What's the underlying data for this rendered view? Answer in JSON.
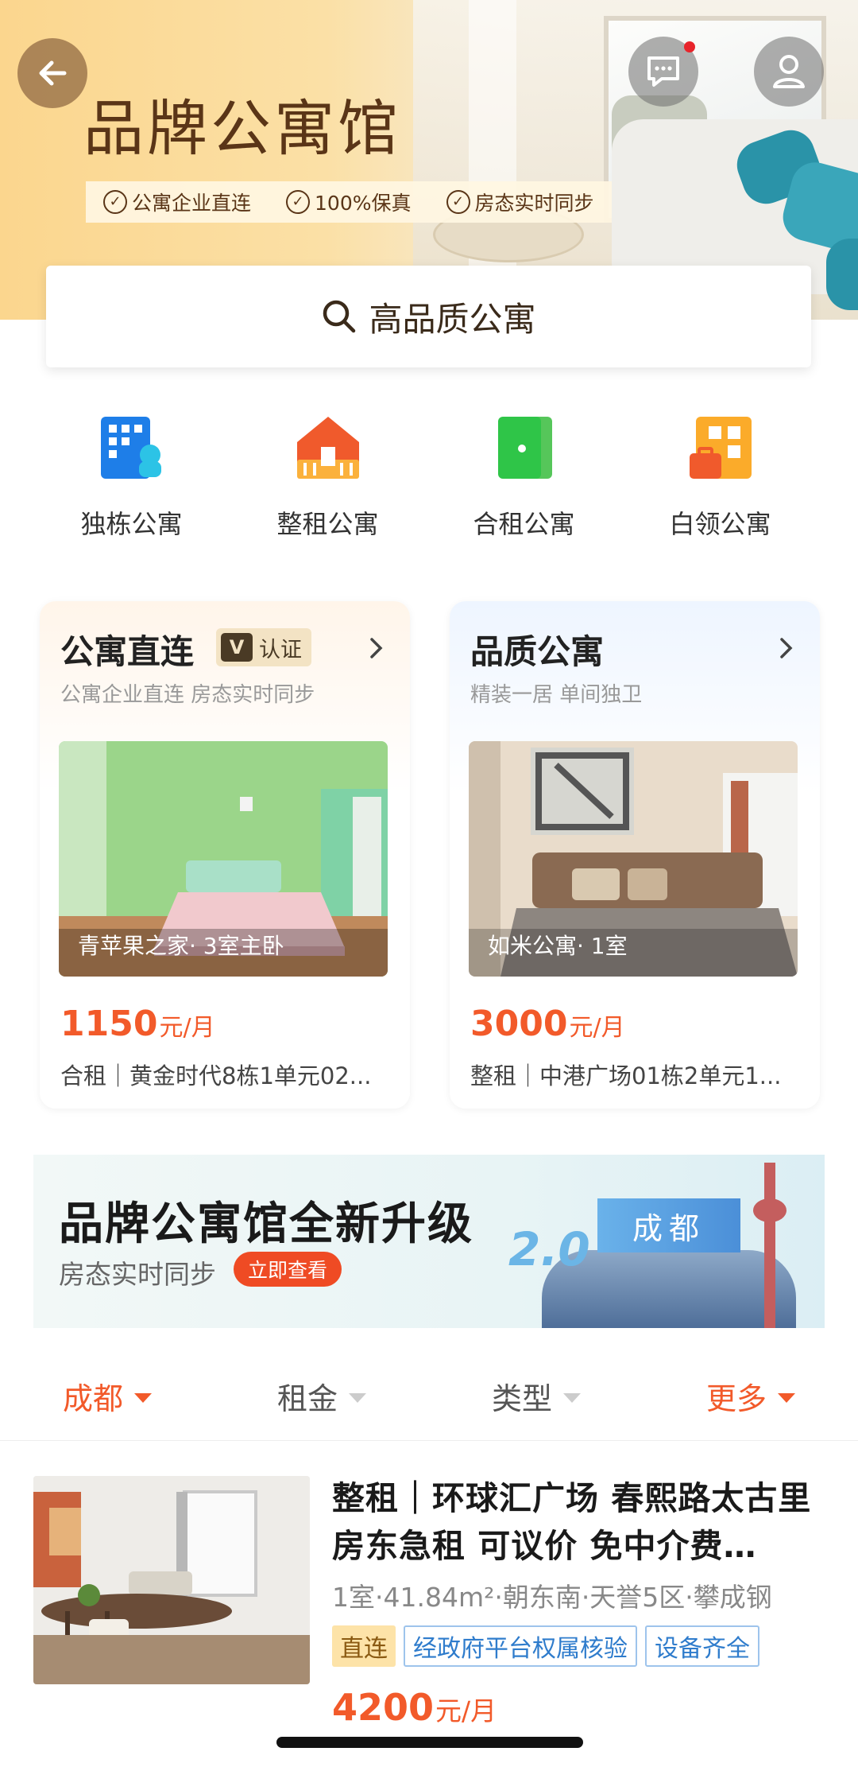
{
  "header": {
    "title": "品牌公寓馆",
    "tags": [
      "公寓企业直连",
      "100%保真",
      "房态实时同步"
    ]
  },
  "search": {
    "placeholder": "高品质公寓"
  },
  "categories": [
    {
      "label": "独栋公寓",
      "icon": "building-icon"
    },
    {
      "label": "整租公寓",
      "icon": "house-icon"
    },
    {
      "label": "合租公寓",
      "icon": "door-icon"
    },
    {
      "label": "白领公寓",
      "icon": "office-icon"
    }
  ],
  "feature_cards": [
    {
      "title": "公寓直连",
      "badge_v": "V",
      "badge": "认证",
      "subtitle": "公寓企业直连 房态实时同步",
      "image_label": "青苹果之家· 3室主卧",
      "price": "1150",
      "unit": "元/月",
      "address": "合租｜黄金时代8栋1单元02..."
    },
    {
      "title": "品质公寓",
      "subtitle": "精装一居 单间独卫",
      "image_label": "如米公寓· 1室",
      "price": "3000",
      "unit": "元/月",
      "address": "整租｜中港广场01栋2单元1..."
    }
  ],
  "promo": {
    "title": "品牌公寓馆全新升级",
    "subtitle": "房态实时同步",
    "button": "立即查看",
    "version": "2.0",
    "city": "成都"
  },
  "filters": [
    {
      "label": "成都",
      "active": true
    },
    {
      "label": "租金",
      "active": false
    },
    {
      "label": "类型",
      "active": false
    },
    {
      "label": "更多",
      "active": true
    }
  ],
  "listing": {
    "title": "整租｜环球汇广场 春熙路太古里 房东急租 可议价 免中介费…",
    "meta": "1室·41.84m²·朝东南·天誉5区·攀成钢",
    "tags": [
      "直连",
      "经政府平台权属核验",
      "设备齐全"
    ],
    "price": "4200",
    "unit": "元/月"
  },
  "colors": {
    "accent": "#f25a2a",
    "brand_brown": "#5a3517",
    "promo_button": "#ef4b24"
  }
}
